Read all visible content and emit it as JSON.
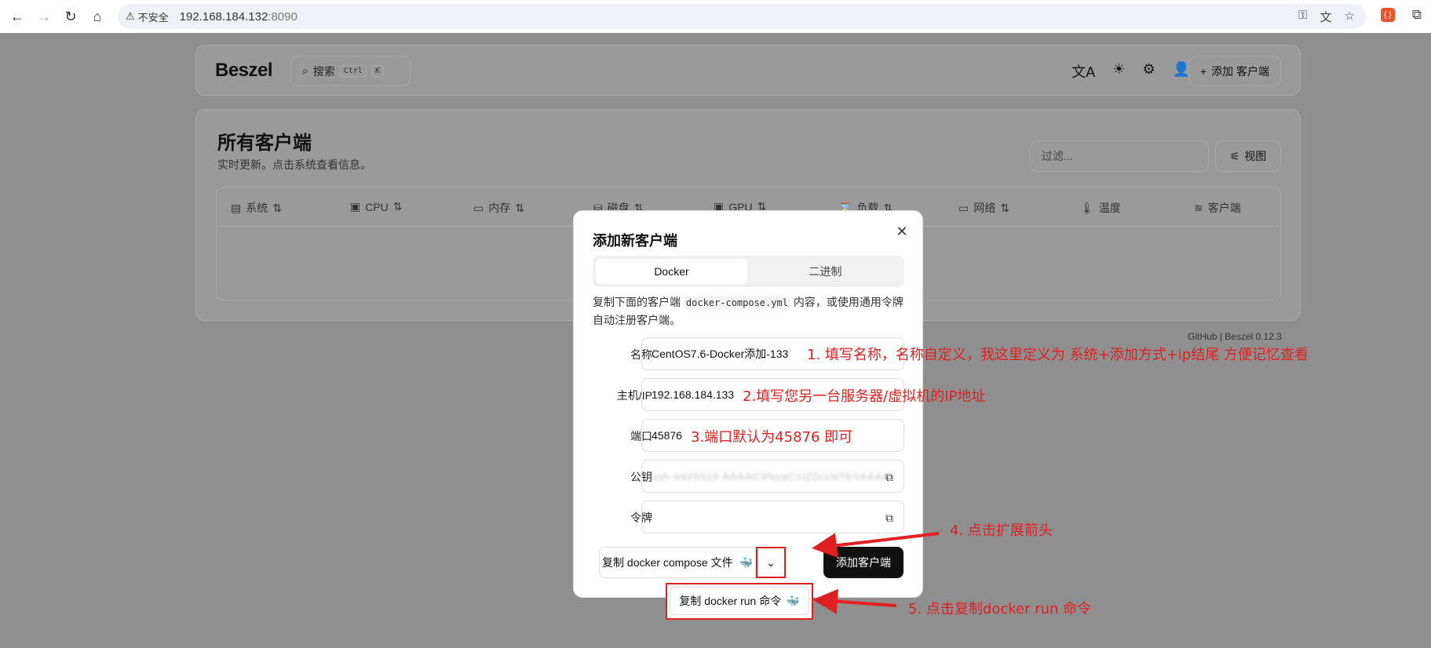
{
  "browser": {
    "security_label": "不安全",
    "url_host": "192.168.184.132",
    "url_port": ":8090",
    "ext_label": "{.}"
  },
  "header": {
    "brand": "Beszel",
    "search_label": "搜索",
    "search_kbd1": "Ctrl",
    "search_kbd2": "K",
    "add_client_label": "添加 客户端"
  },
  "main": {
    "title": "所有客户端",
    "subtitle": "实时更新。点击系统查看信息。",
    "filter_placeholder": "过滤...",
    "view_label": "视图",
    "columns": [
      "系统",
      "CPU",
      "内存",
      "磁盘",
      "GPU",
      "负载",
      "网络",
      "温度",
      "客户端"
    ],
    "footer": "GitHub | Beszel 0.12.3"
  },
  "modal": {
    "title": "添加新客户端",
    "tab_docker": "Docker",
    "tab_binary": "二进制",
    "desc_pre": "复制下面的客户端 ",
    "desc_code": "docker-compose.yml",
    "desc_post": " 内容，或使用通用令牌自动注册客户端。",
    "name_label": "名称",
    "name_value": "CentOS7.6-Docker添加-133",
    "host_label": "主机/IP",
    "host_value": "192.168.184.133",
    "port_label": "端口",
    "port_value": "45876",
    "pubkey_label": "公钥",
    "pubkey_value": "ssh-ed25519 AAAAC3NzaC1lZDI1NTE5AAAA",
    "token_label": "令牌",
    "copy_compose_label": "复制 docker compose 文件",
    "submit_label": "添加客户端",
    "dropdown_item": "复制 docker run 命令"
  },
  "annotations": {
    "a1": "1. 填写名称，名称自定义，我这里定义为 系统+添加方式+ip结尾 方便记忆查看",
    "a2": "2.填写您另一台服务器/虚拟机的IP地址",
    "a3": "3.端口默认为45876 即可",
    "a4": "4. 点击扩展箭头",
    "a5": "5. 点击复制docker run 命令"
  },
  "colors": {
    "annotation": "#e02020",
    "overlay": "#8f8f8f",
    "primary_button": "#111111"
  }
}
